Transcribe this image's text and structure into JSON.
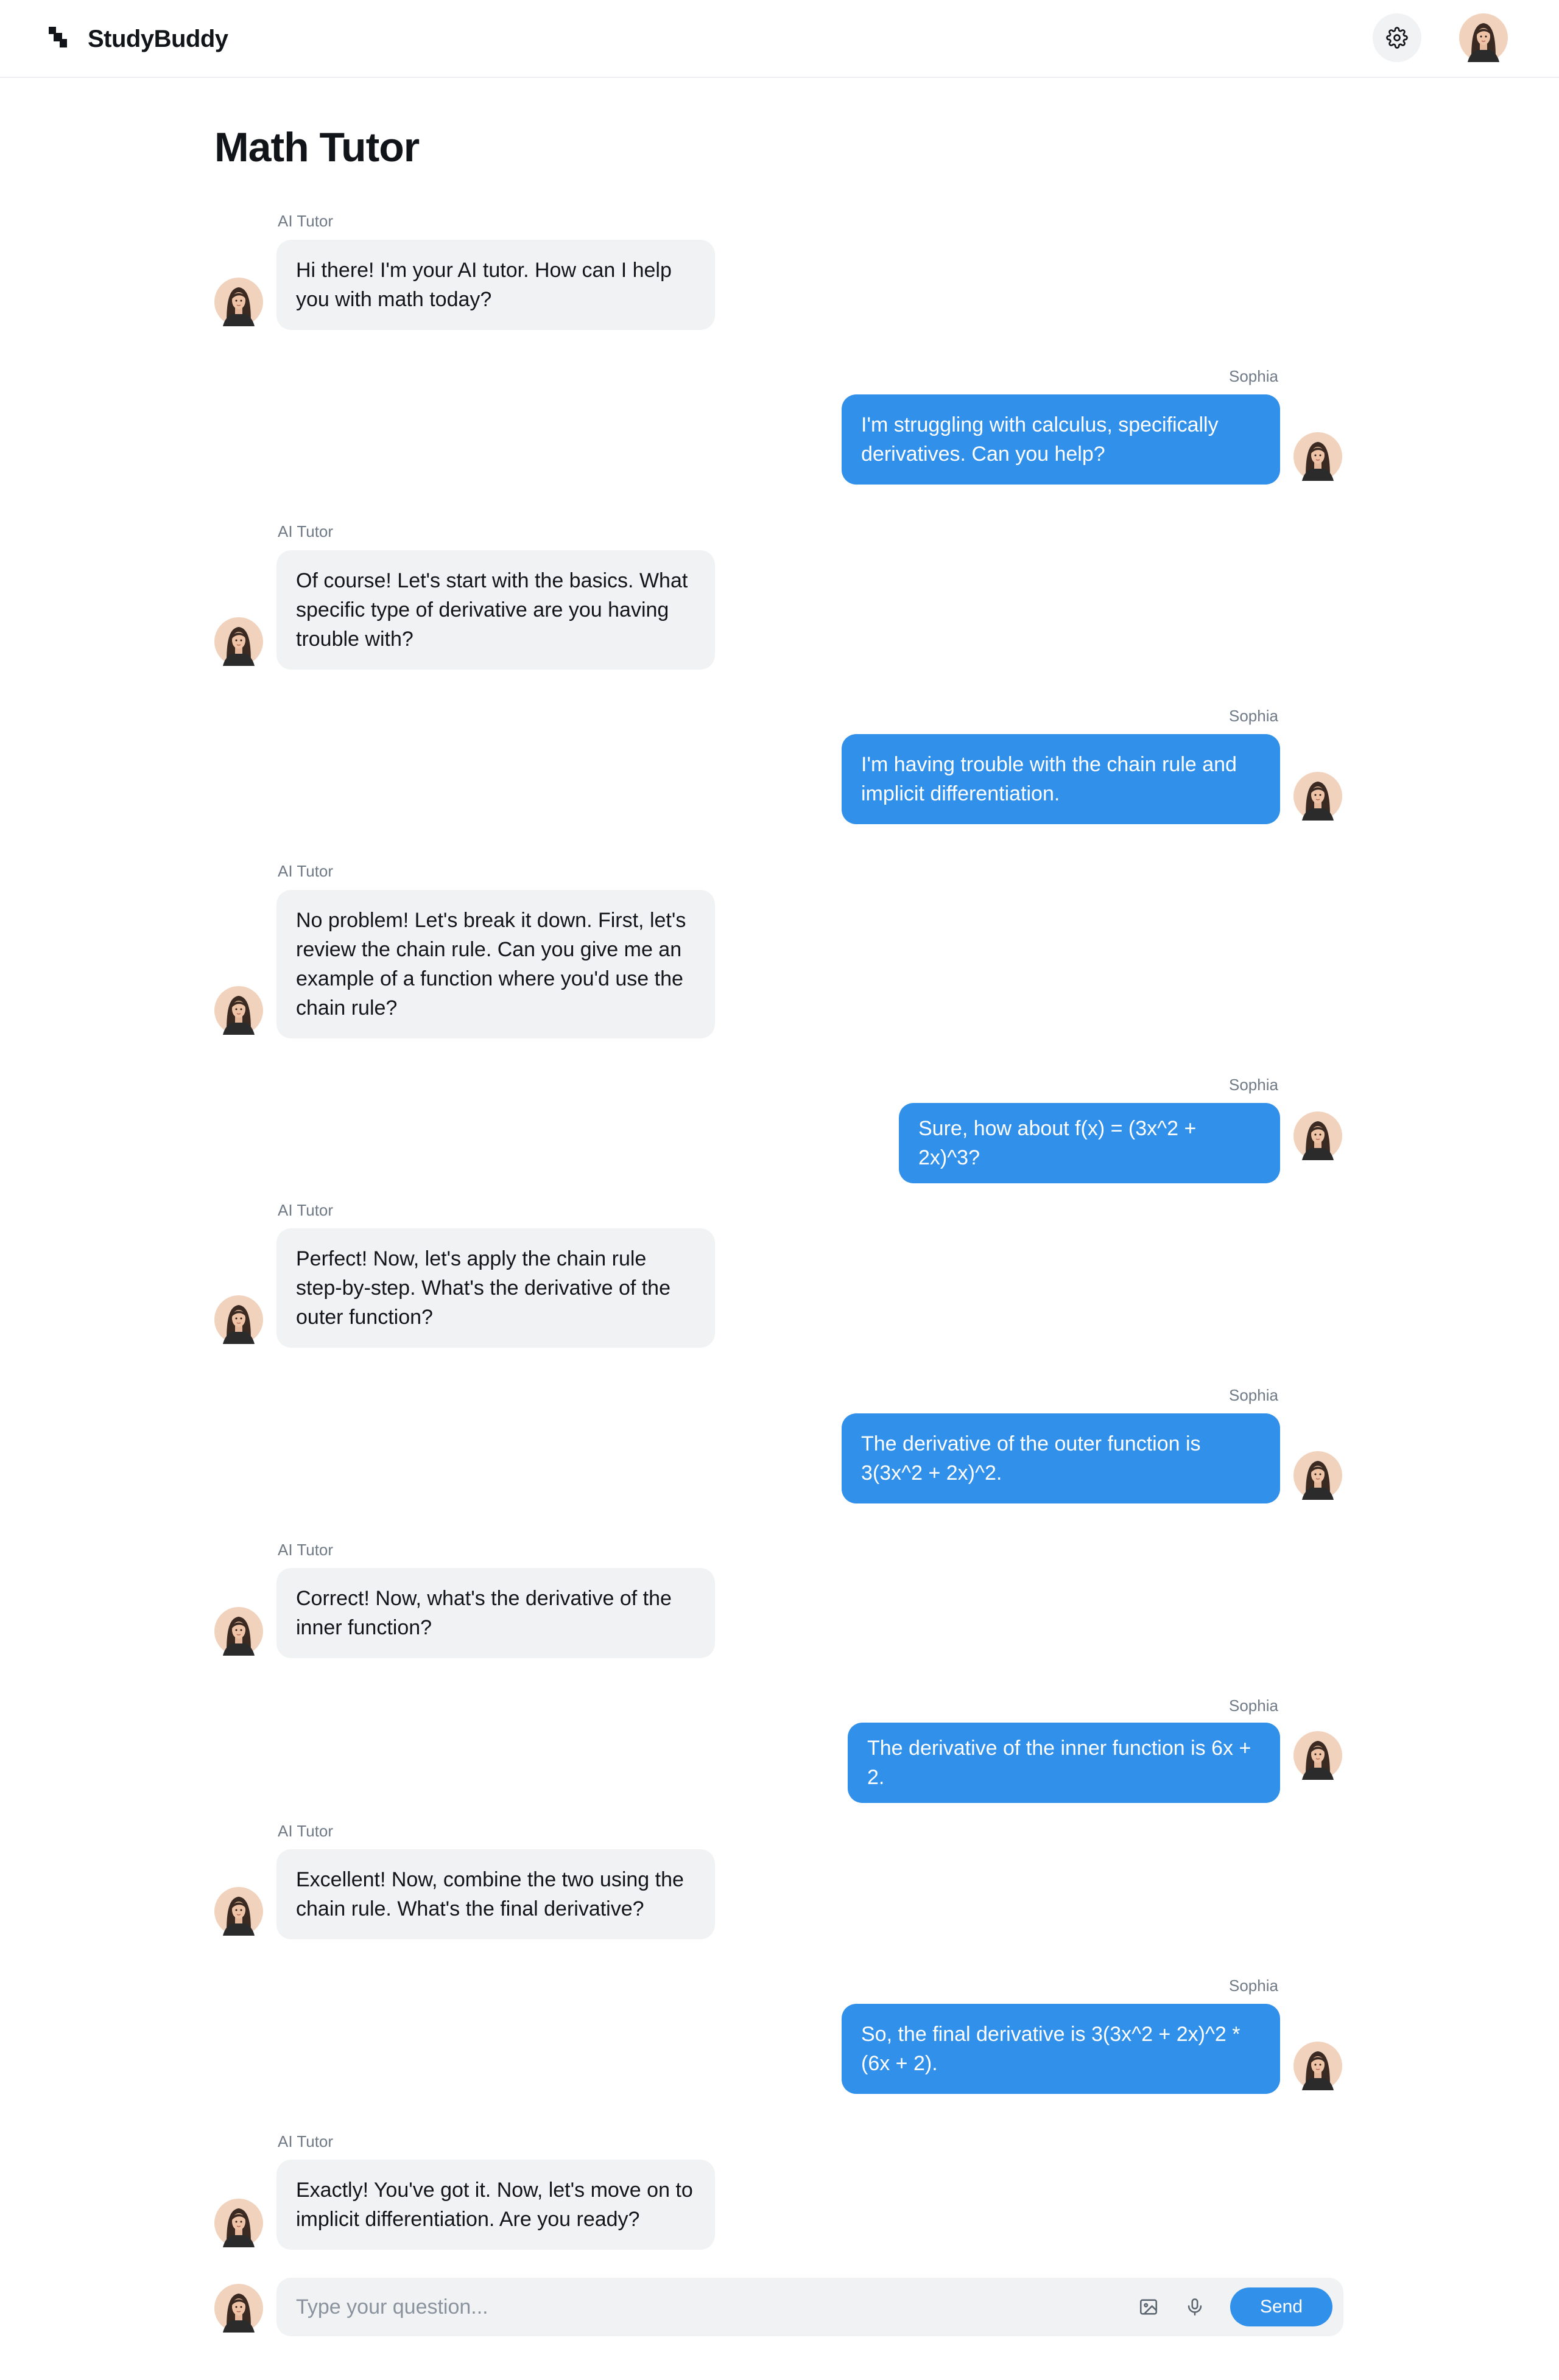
{
  "app": {
    "name": "StudyBuddy"
  },
  "header": {
    "settings_icon": "gear-icon",
    "avatar_icon": "user-avatar"
  },
  "page": {
    "title": "Math Tutor"
  },
  "messages": [
    {
      "sender": "AI Tutor",
      "role": "tutor",
      "text": "Hi there! I'm your AI tutor. How can I help you with math today?"
    },
    {
      "sender": "Sophia",
      "role": "user",
      "text": "I'm struggling with calculus, specifically derivatives. Can you help?"
    },
    {
      "sender": "AI Tutor",
      "role": "tutor",
      "text": "Of course! Let's start with the basics. What specific type of derivative are you having trouble with?"
    },
    {
      "sender": "Sophia",
      "role": "user",
      "text": "I'm having trouble with the chain rule and implicit differentiation."
    },
    {
      "sender": "AI Tutor",
      "role": "tutor",
      "text": "No problem! Let's break it down. First, let's review the chain rule. Can you give me an example of a function where you'd use the chain rule?"
    },
    {
      "sender": "Sophia",
      "role": "user",
      "text": "Sure, how about f(x) = (3x^2 + 2x)^3?"
    },
    {
      "sender": "AI Tutor",
      "role": "tutor",
      "text": "Perfect! Now, let's apply the chain rule step-by-step. What's the derivative of the outer function?"
    },
    {
      "sender": "Sophia",
      "role": "user",
      "text": "The derivative of the outer function is 3(3x^2 + 2x)^2."
    },
    {
      "sender": "AI Tutor",
      "role": "tutor",
      "text": "Correct! Now, what's the derivative of the inner function?"
    },
    {
      "sender": "Sophia",
      "role": "user",
      "text": "The derivative of the inner function is 6x + 2."
    },
    {
      "sender": "AI Tutor",
      "role": "tutor",
      "text": "Excellent! Now, combine the two using the chain rule. What's the final derivative?"
    },
    {
      "sender": "Sophia",
      "role": "user",
      "text": "So, the final derivative is 3(3x^2 + 2x)^2 * (6x + 2)."
    },
    {
      "sender": "AI Tutor",
      "role": "tutor",
      "text": "Exactly! You've got it. Now, let's move on to implicit differentiation. Are you ready?"
    }
  ],
  "composer": {
    "placeholder": "Type your question...",
    "send_label": "Send",
    "image_icon": "image-icon",
    "mic_icon": "microphone-icon"
  },
  "colors": {
    "accent": "#3190e9",
    "tutor_bubble": "#f0f2f4",
    "muted_text": "#6f7a86"
  }
}
